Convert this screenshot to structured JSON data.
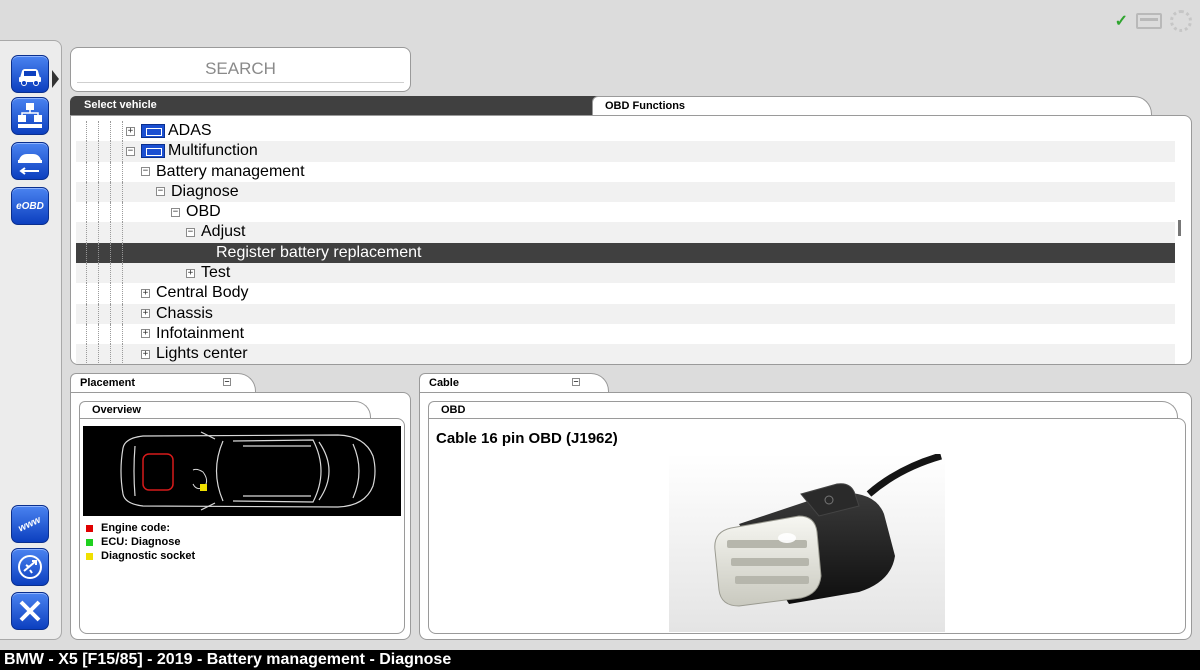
{
  "status_icons": [
    "check-icon",
    "battery-icon",
    "spinner-icon"
  ],
  "check_mark": "✓",
  "sidebar": {
    "buttons": [
      {
        "name": "vehicle",
        "icon": "car-icon"
      },
      {
        "name": "diagnose",
        "icon": "diagnostic-tree-icon"
      },
      {
        "name": "lift",
        "icon": "car-lift-icon"
      },
      {
        "name": "eobd",
        "label": "eOBD"
      }
    ],
    "bottom_buttons": [
      {
        "name": "www",
        "label": "www"
      },
      {
        "name": "flight-mode",
        "icon": "airplane-icon"
      },
      {
        "name": "exit",
        "icon": "close-icon"
      }
    ]
  },
  "search": {
    "placeholder": "SEARCH"
  },
  "tabs": {
    "select_vehicle": "Select vehicle",
    "obd_functions": "OBD Functions"
  },
  "tree": [
    {
      "label": "ADAS",
      "expander": "+",
      "icon": "module-icon"
    },
    {
      "label": "Multifunction",
      "expander": "−",
      "icon": "module-icon"
    },
    {
      "label": "Battery management",
      "expander": "−"
    },
    {
      "label": "Diagnose",
      "expander": "−"
    },
    {
      "label": "OBD",
      "expander": "−"
    },
    {
      "label": "Adjust",
      "expander": "−"
    },
    {
      "label": "Register battery replacement",
      "selected": true
    },
    {
      "label": "Test",
      "expander": "+"
    },
    {
      "label": "Central Body",
      "expander": "+"
    },
    {
      "label": "Chassis",
      "expander": "+"
    },
    {
      "label": "Infotainment",
      "expander": "+"
    },
    {
      "label": "Lights center",
      "expander": "+"
    }
  ],
  "placement": {
    "tab": "Placement",
    "overview_tab": "Overview",
    "legend": [
      {
        "label": "Engine code:",
        "color": "#e00000"
      },
      {
        "label": "ECU: Diagnose",
        "color": "#1fd11f"
      },
      {
        "label": "Diagnostic socket",
        "color": "#f0e000"
      }
    ]
  },
  "cable": {
    "tab": "Cable",
    "obd_tab": "OBD",
    "title": "Cable 16 pin OBD (J1962)"
  },
  "collapse_symbol": "−",
  "statusbar": {
    "text": "BMW - X5 [F15/85] - 2019 - Battery management - Diagnose"
  },
  "colors": {
    "accent": "#1b4fd1",
    "selected_row": "#404040"
  }
}
